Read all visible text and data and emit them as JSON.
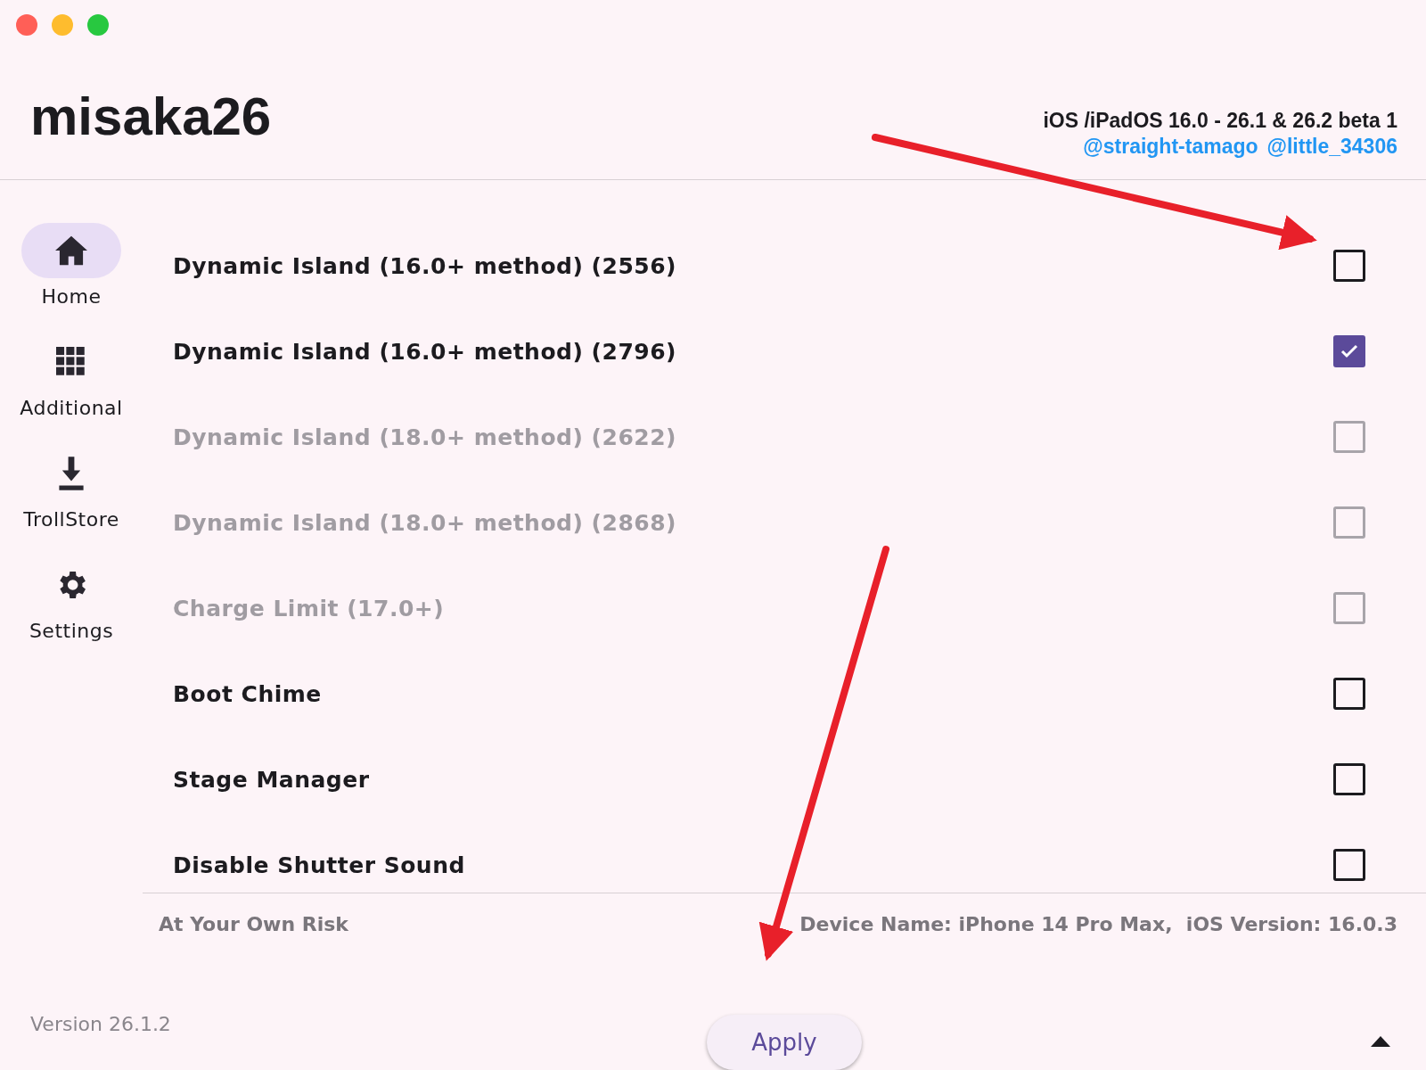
{
  "window": {
    "controls": [
      {
        "kind": "close"
      },
      {
        "kind": "minimize"
      },
      {
        "kind": "zoom"
      }
    ]
  },
  "header": {
    "title": "misaka26",
    "subtitle": "iOS /iPadOS 16.0 - 26.1 & 26.2 beta 1",
    "credits": [
      "@straight-tamago",
      "@little_34306"
    ]
  },
  "sidebar": {
    "items": [
      {
        "label": "Home",
        "kind": "home",
        "selected": true
      },
      {
        "label": "Additional",
        "kind": "grid",
        "selected": false
      },
      {
        "label": "TrollStore",
        "kind": "download",
        "selected": false
      },
      {
        "label": "Settings",
        "kind": "gear",
        "selected": false
      }
    ],
    "version": "Version 26.1.2"
  },
  "options": [
    {
      "label": "Dynamic Island (16.0+ method) (2556)",
      "checked": false,
      "disabled": false
    },
    {
      "label": "Dynamic Island (16.0+ method) (2796)",
      "checked": true,
      "disabled": false
    },
    {
      "label": "Dynamic Island (18.0+ method) (2622)",
      "checked": false,
      "disabled": true
    },
    {
      "label": "Dynamic Island (18.0+ method) (2868)",
      "checked": false,
      "disabled": true
    },
    {
      "label": "Charge Limit (17.0+)",
      "checked": false,
      "disabled": true
    },
    {
      "label": "Boot Chime",
      "checked": false,
      "disabled": false
    },
    {
      "label": "Stage Manager",
      "checked": false,
      "disabled": false
    },
    {
      "label": "Disable Shutter Sound",
      "checked": false,
      "disabled": false
    }
  ],
  "status": {
    "warning": "At Your Own Risk",
    "device": "Device Name: iPhone 14 Pro Max,  iOS Version: 16.0.3"
  },
  "apply_button": "Apply"
}
